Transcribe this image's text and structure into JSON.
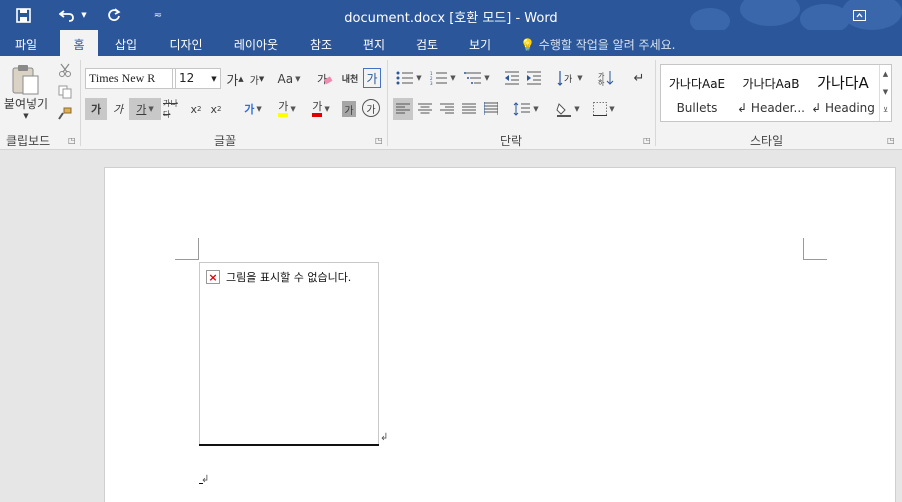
{
  "window": {
    "title": "document.docx [호환 모드] - Word"
  },
  "tabs": [
    {
      "label": "파일"
    },
    {
      "label": "홈",
      "active": true
    },
    {
      "label": "삽입"
    },
    {
      "label": "디자인"
    },
    {
      "label": "레이아웃"
    },
    {
      "label": "참조"
    },
    {
      "label": "편지"
    },
    {
      "label": "검토"
    },
    {
      "label": "보기"
    }
  ],
  "tell_me": {
    "placeholder": "수행할 작업을 알려 주세요."
  },
  "ribbon": {
    "clipboard": {
      "group_label": "클립보드",
      "paste_label": "붙여넣기"
    },
    "font": {
      "group_label": "글꼴",
      "font_name": "Times New R",
      "font_size": "12",
      "grow_label": "가",
      "shrink_label": "가",
      "case_label": "Aa",
      "phonetic_label": "내천",
      "bold_label": "가",
      "italic_label": "가",
      "underline_label": "가",
      "strike_label": "가나다",
      "sub_label": "x",
      "sup_label": "x",
      "effects_label": "가",
      "highlight_label": "가",
      "color_label": "가",
      "shade_label": "가",
      "enclose_label": "가",
      "border_char_label": "가"
    },
    "paragraph": {
      "group_label": "단락"
    },
    "styles": {
      "group_label": "스타일",
      "items": [
        {
          "preview": "가나다AaE",
          "name": "Bullets"
        },
        {
          "preview": "가나다AaB",
          "name": "↲ Header..."
        },
        {
          "preview": "가나다A",
          "name": "↲ Heading"
        }
      ]
    }
  },
  "document": {
    "broken_image_message": "그림을 표시할 수 없습니다.",
    "paragraph_mark": "↲"
  },
  "colors": {
    "word_blue": "#2b579a",
    "ribbon_bg": "#f3f3f3",
    "highlight_yellow": "#ffff00",
    "font_red": "#e00000"
  }
}
